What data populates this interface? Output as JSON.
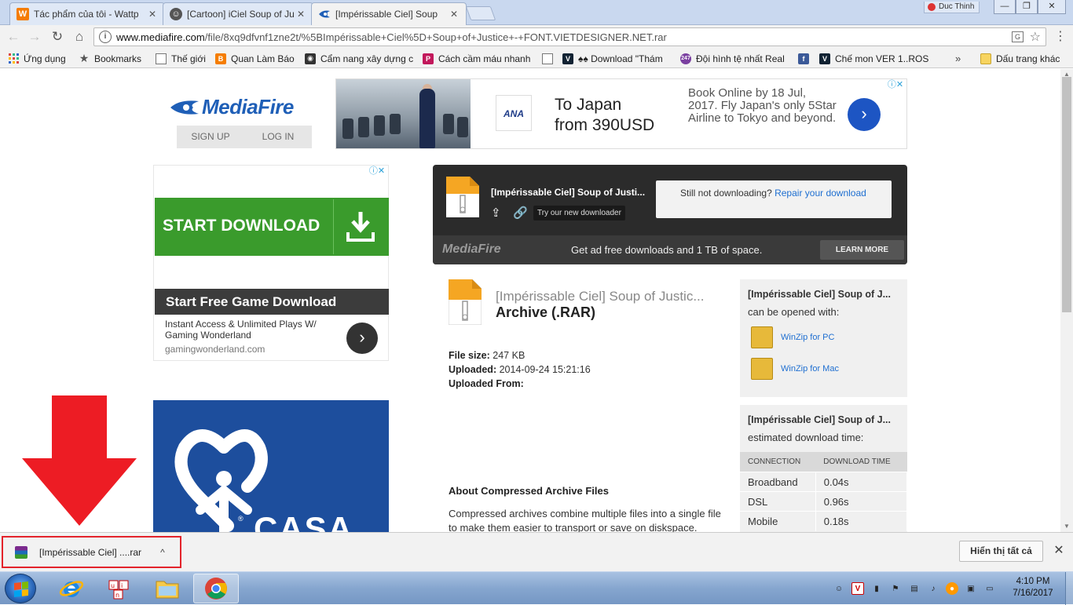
{
  "browser": {
    "tabs": [
      {
        "title": "Tác phẩm của tôi - Wattp",
        "favicon": "wattpad-icon",
        "active": false
      },
      {
        "title": "[Cartoon] iCiel Soup of Ju",
        "favicon": "reader-icon",
        "active": false
      },
      {
        "title": "[Impérissable Ciel] Soup",
        "favicon": "mediafire-icon",
        "active": true
      }
    ],
    "close_glyph": "✕",
    "user_name": "Duc Thinh",
    "window_buttons": {
      "minimize": "—",
      "maximize": "❐",
      "close": "✕"
    },
    "nav": {
      "back": "←",
      "forward": "→",
      "reload": "↻",
      "home": "⌂"
    },
    "address": {
      "domain": "www.mediafire.com",
      "path": "/file/8xq9dfvnf1zne2t/%5BImpérissable+Ciel%5D+Soup+of+Justice+-+FONT.VIETDESIGNER.NET.rar"
    },
    "bookmarks": [
      {
        "label": "Ứng dụng",
        "icon": "apps-grid-icon"
      },
      {
        "label": "Bookmarks",
        "icon": "star-icon"
      },
      {
        "label": "Thế giới",
        "icon": "page-icon"
      },
      {
        "label": "Quan Làm Báo",
        "icon": "blogger-icon"
      },
      {
        "label": "Cẩm nang xây dựng c",
        "icon": "photo-icon"
      },
      {
        "label": "Cách cầm máu nhanh",
        "icon": "p-icon"
      },
      {
        "label": "",
        "icon": "page-icon"
      },
      {
        "label": "♠♠ Download \"Thám",
        "icon": "vn-icon"
      },
      {
        "label": "Đội hình tệ nhất Real",
        "icon": "247-icon"
      },
      {
        "label": "",
        "icon": "facebook-icon"
      },
      {
        "label": "Chế mon VER 1..ROS",
        "icon": "vn-icon"
      }
    ],
    "bookmarks_overflow": "»",
    "other_bookmarks": "Dấu trang khác"
  },
  "page": {
    "logo_text": "MediaFire",
    "signup": "SIGN UP",
    "login": "LOG IN",
    "top_ad": {
      "brand": "ANA",
      "headline_line1": "To Japan",
      "headline_line2": "from 390USD",
      "body": "Book Online by 18 Jul, 2017. Fly Japan's only 5Star Airline to Tokyo and beyond.",
      "arrow": "›"
    },
    "adchoices": "ⓘ✕",
    "side_ad": {
      "button": "START DOWNLOAD",
      "bar_title": "Start Free Game Download",
      "description": "Instant Access & Unlimited Plays W/ Gaming Wonderland",
      "domain": "gamingwonderland.com",
      "arrow": "›"
    },
    "casa": {
      "word": "CASA",
      "reg": "®"
    },
    "download_panel": {
      "file_name": "[Impérissable Ciel] Soup of Justi...",
      "try_new": "Try our new downloader",
      "still_text": "Still not downloading?",
      "repair_link": "Repair your download",
      "footer_logo": "MediaFire",
      "footer_msg": "Get ad free downloads and 1 TB of space.",
      "learn_more": "LEARN MORE"
    },
    "file_info": {
      "name": "[Impérissable Ciel] Soup of Justic...",
      "type": "Archive (.RAR)",
      "size_label": "File size:",
      "size_value": "247 KB",
      "uploaded_label": "Uploaded:",
      "uploaded_value": "2014-09-24 15:21:16",
      "from_label": "Uploaded From:",
      "about_title": "About Compressed Archive Files",
      "about_text": "Compressed archives combine multiple files into a single file to make them easier to transport or save on diskspace. Archiving software may also provide options for encryption, file spanning, checksums, self-extraction, and self-installation. Zip is the most-widely used format, used by the Windows operating system and more recently by OSX as well. RAR is also a very popular and"
    },
    "open_with": {
      "title": "[Impérissable Ciel] Soup of J...",
      "subtitle": "can be opened with:",
      "apps": [
        "WinZip for PC",
        "WinZip for Mac"
      ]
    },
    "download_time": {
      "title": "[Impérissable Ciel] Soup of J...",
      "subtitle": "estimated download time:",
      "headers": [
        "CONNECTION",
        "DOWNLOAD TIME"
      ],
      "rows": [
        [
          "Broadband",
          "0.04s"
        ],
        [
          "DSL",
          "0.96s"
        ],
        [
          "Mobile",
          "0.18s"
        ]
      ]
    }
  },
  "shelf": {
    "item_name": "[Impérissable Ciel] ....rar",
    "chevron": "^",
    "show_all": "Hiển thị tất cả",
    "close": "✕"
  },
  "taskbar": {
    "time": "4:10 PM",
    "date": "7/16/2017"
  },
  "colors": {
    "mediafire_blue": "#1f5fb7",
    "highlight_red": "#e3232b",
    "ad_green": "#3a9b2c"
  }
}
